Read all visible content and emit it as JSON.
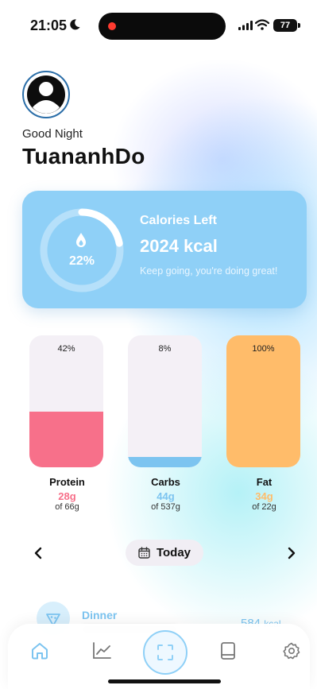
{
  "status_bar": {
    "time": "21:05",
    "battery": "77"
  },
  "header": {
    "greeting": "Good Night",
    "username": "TuananhDo"
  },
  "calories": {
    "percent_label": "22%",
    "percent": 22,
    "title": "Calories Left",
    "value": "2024 kcal",
    "message": "Keep going, you're doing great!"
  },
  "macros": [
    {
      "name": "Protein",
      "percent_label": "42%",
      "fill_fraction": 0.42,
      "amount": "28g",
      "of": "of 66g",
      "color": "#f7708a"
    },
    {
      "name": "Carbs",
      "percent_label": "8%",
      "fill_fraction": 0.08,
      "amount": "44g",
      "of": "of 537g",
      "color": "#7cc4f0"
    },
    {
      "name": "Fat",
      "percent_label": "100%",
      "fill_fraction": 1.0,
      "amount": "34g",
      "of": "of 22g",
      "color": "#ffbc6a"
    }
  ],
  "date_nav": {
    "label": "Today",
    "prev_icon": "chevron-left-icon",
    "next_icon": "chevron-right-icon"
  },
  "meal": {
    "name": "Dinner",
    "kcal": "584",
    "unit": "kcal",
    "icon": "pizza-icon"
  },
  "tab_bar": {
    "icons": [
      "home-icon",
      "chart-icon",
      "scan-icon",
      "book-icon",
      "gear-icon"
    ],
    "active": "home-icon"
  },
  "colors": {
    "accent": "#8fd0f7",
    "protein": "#f7708a",
    "carbs": "#7cc4f0",
    "fat": "#ffbc6a"
  }
}
